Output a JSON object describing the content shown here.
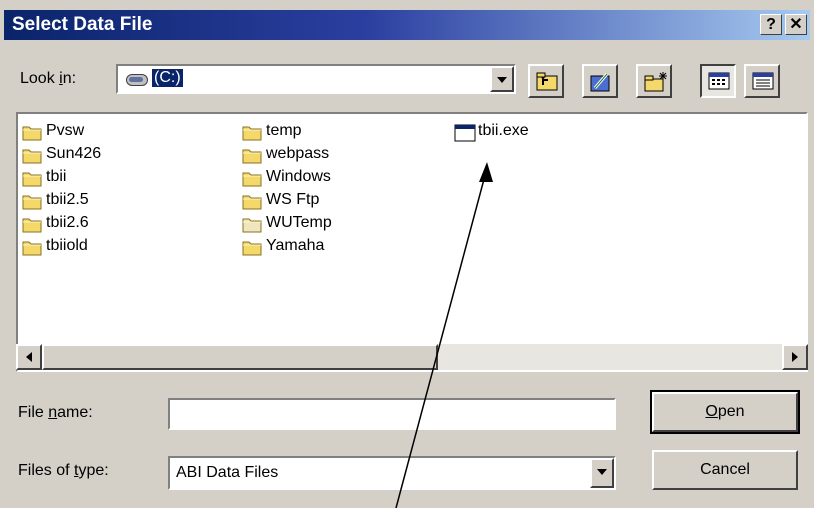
{
  "dialog": {
    "title": "Select Data File",
    "help_btn": "?",
    "close_btn": "✕"
  },
  "lookin": {
    "label_pre": "Look ",
    "label_u": "i",
    "label_post": "n:",
    "value": "(C:)"
  },
  "files": [
    {
      "name": "Pvsw",
      "type": "folder"
    },
    {
      "name": "Sun426",
      "type": "folder"
    },
    {
      "name": "tbii",
      "type": "folder"
    },
    {
      "name": "tbii2.5",
      "type": "folder"
    },
    {
      "name": "tbii2.6",
      "type": "folder"
    },
    {
      "name": "tbiiold",
      "type": "folder"
    },
    {
      "name": "temp",
      "type": "folder"
    },
    {
      "name": "webpass",
      "type": "folder"
    },
    {
      "name": "Windows",
      "type": "folder"
    },
    {
      "name": "WS Ftp",
      "type": "folder"
    },
    {
      "name": "WUTemp",
      "type": "folder-light"
    },
    {
      "name": "Yamaha",
      "type": "folder"
    },
    {
      "name": "tbii.exe",
      "type": "exe"
    }
  ],
  "filename": {
    "label_pre": "File ",
    "label_u": "n",
    "label_post": "ame:",
    "value": ""
  },
  "filetype": {
    "label_pre": "Files of ",
    "label_u": "t",
    "label_post": "ype:",
    "value": "ABI Data Files"
  },
  "buttons": {
    "open_u": "O",
    "open_rest": "pen",
    "cancel": "Cancel"
  }
}
